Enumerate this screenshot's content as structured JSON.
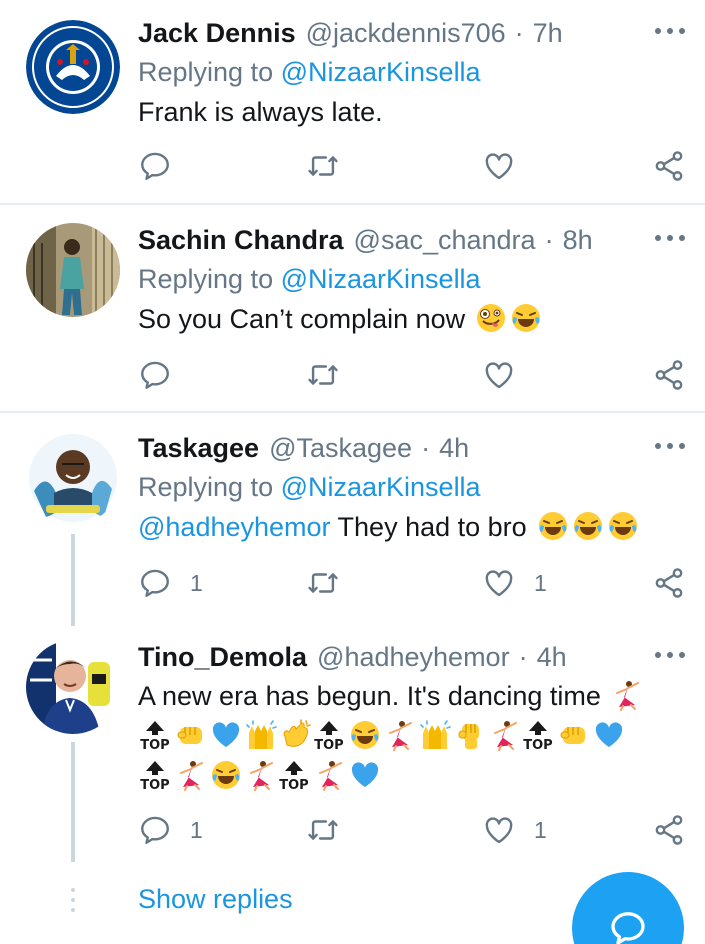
{
  "tweets": [
    {
      "name": "Jack Dennis",
      "handle": "@jackdennis706",
      "sep": "·",
      "time": "7h",
      "replying_prefix": "Replying to ",
      "replying_to": "@NizaarKinsella",
      "text": "Frank is always late.",
      "reply_count": "",
      "like_count": "",
      "avatar": "chelsea-fc-crest"
    },
    {
      "name": "Sachin Chandra",
      "handle": "@sac_chandra",
      "sep": "·",
      "time": "8h",
      "replying_prefix": "Replying to ",
      "replying_to": "@NizaarKinsella",
      "text": "So you Can’t complain now",
      "reply_count": "",
      "like_count": "",
      "avatar": "person-photo"
    },
    {
      "name": "Taskagee",
      "handle": "@Taskagee",
      "sep": "·",
      "time": "4h",
      "replying_prefix": "Replying to ",
      "replying_to": "@NizaarKinsella",
      "mention": "@hadheyhemor",
      "text": " They had to bro",
      "reply_count": "1",
      "like_count": "1",
      "avatar": "person-artwork"
    },
    {
      "name": "Tino_Demola",
      "handle": "@hadheyhemor",
      "sep": "·",
      "time": "4h",
      "text": "A new era has begun. It's dancing time",
      "reply_count": "1",
      "like_count": "1",
      "avatar": "person-chelsea-shirt"
    }
  ],
  "emoji_label": "TOP",
  "show_replies": "Show replies",
  "colors": {
    "link": "#1b95e0",
    "muted": "#657786",
    "fab": "#1da1f2",
    "divider": "#e6ecf0"
  },
  "icons": [
    "reply-icon",
    "retweet-icon",
    "like-icon",
    "share-icon",
    "more-icon",
    "compose-icon"
  ]
}
